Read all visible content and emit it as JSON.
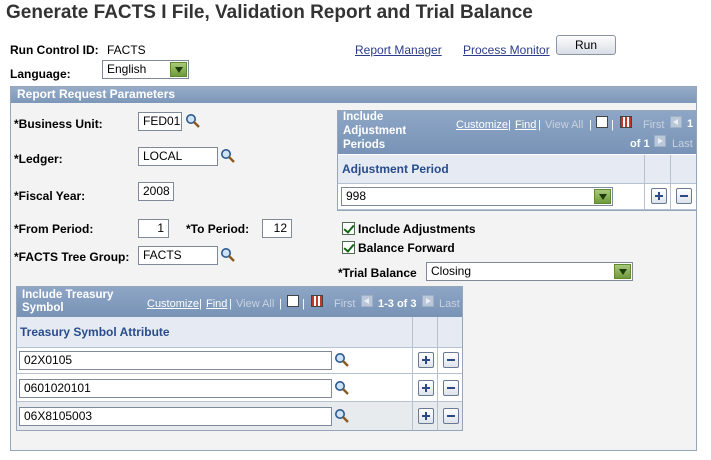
{
  "page": {
    "title": "Generate FACTS I File, Validation Report and Trial Balance"
  },
  "header": {
    "run_control_label": "Run Control ID:",
    "run_control_value": "FACTS",
    "report_manager": "Report Manager",
    "process_monitor": "Process Monitor",
    "run_button": "Run",
    "language_label": "Language:",
    "language_value": "English"
  },
  "params": {
    "title": "Report Request Parameters",
    "business_unit_label": "*Business Unit:",
    "business_unit_value": "FED01",
    "ledger_label": "*Ledger:",
    "ledger_value": "LOCAL",
    "fiscal_year_label": "*Fiscal Year:",
    "fiscal_year_value": "2008",
    "from_period_label": "*From Period:",
    "from_period_value": "1",
    "to_period_label": "*To Period:",
    "to_period_value": "12",
    "tree_group_label": "*FACTS Tree Group:",
    "tree_group_value": "FACTS",
    "include_adjustments": "Include Adjustments",
    "balance_forward": "Balance Forward",
    "trial_balance_label": "*Trial Balance",
    "trial_balance_value": "Closing"
  },
  "adj_grid": {
    "title": "Include Adjustment Periods",
    "customize": "Customize",
    "find": "Find",
    "view_all": "View All",
    "first": "First",
    "range_num": "1",
    "range_of": "of 1",
    "last": "Last",
    "col_header": "Adjustment Period",
    "rows": [
      {
        "value": "998"
      }
    ]
  },
  "treasury_grid": {
    "title": "Include Treasury Symbol",
    "customize": "Customize",
    "find": "Find",
    "view_all": "View All",
    "first": "First",
    "range": "1-3 of 3",
    "last": "Last",
    "col_header": "Treasury Symbol Attribute",
    "rows": [
      {
        "value": "02X0105"
      },
      {
        "value": "0601020101"
      },
      {
        "value": "06X8105003"
      }
    ]
  },
  "colors": {
    "title_text": "#333333",
    "link": "#2b3c8a",
    "group_bar": "#7d97b9",
    "select_arrow": "#6f9a3c"
  },
  "icons": {
    "lookup": "magnifier-icon",
    "add": "plus-icon",
    "delete": "minus-icon",
    "zoom": "view-icon",
    "download": "spreadsheet-icon"
  }
}
